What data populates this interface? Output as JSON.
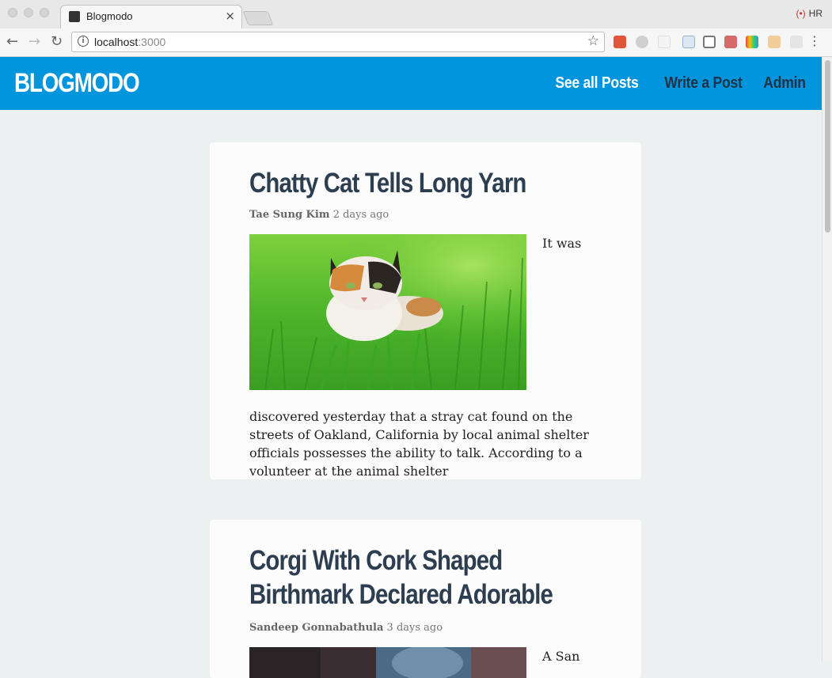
{
  "browser": {
    "tab_title": "Blogmodo",
    "tab_close": "×",
    "url_host": "localhost",
    "url_port": ":3000",
    "profile_label": "HR",
    "back_glyph": "←",
    "forward_glyph": "→",
    "reload_glyph": "↻",
    "star_glyph": "☆",
    "info_glyph": "i",
    "menu_glyph": "⋮",
    "extension_icons": [
      "youtube-icon",
      "feedly-icon",
      "blank-icon",
      "calendar-icon",
      "cast-icon",
      "puzzle-icon",
      "rainbow-icon",
      "face-icon",
      "toggle-icon"
    ]
  },
  "site": {
    "logo": "BLOGMODO",
    "nav": [
      "See all Posts",
      "Write a Post",
      "Admin"
    ],
    "active_nav": "See all Posts",
    "header_color": "#0095dd"
  },
  "posts": [
    {
      "title_lines": [
        "Chatty Cat Tells Long Yarn"
      ],
      "author": "Tae Sung Kim",
      "time": "2 days ago",
      "image": "calico-cat-in-grass",
      "body_start": "It was",
      "excerpt": "discovered yesterday that a stray cat found on the streets of Oakland, California by local animal shelter officials possesses the ability to talk. According to a volunteer at the animal shelter"
    },
    {
      "title_lines": [
        "Corgi With Cork Shaped",
        "Birthmark Declared Adorable"
      ],
      "author": "Sandeep Gonnabathula",
      "time": "3 days ago",
      "image": "corgi-photo",
      "body_start": "A San"
    }
  ]
}
